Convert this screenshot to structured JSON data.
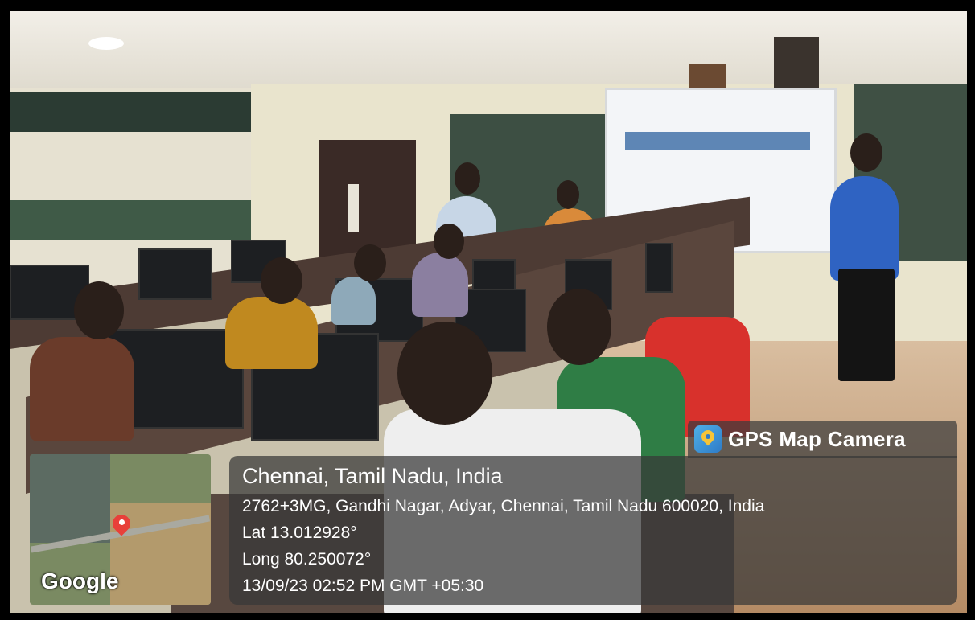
{
  "overlay": {
    "app_name": "GPS Map Camera",
    "app_icon": "gps-map-camera-icon",
    "place": "Chennai, Tamil Nadu, India",
    "address": "2762+3MG, Gandhi Nagar, Adyar, Chennai, Tamil Nadu 600020, India",
    "lat": "Lat 13.012928°",
    "long": "Long 80.250072°",
    "datetime": "13/09/23 02:52 PM GMT +05:30",
    "map_label": "Google"
  },
  "colors": {
    "overlay_bg": "#373737",
    "pin": "#e8403a",
    "chair": "#d8312c"
  }
}
